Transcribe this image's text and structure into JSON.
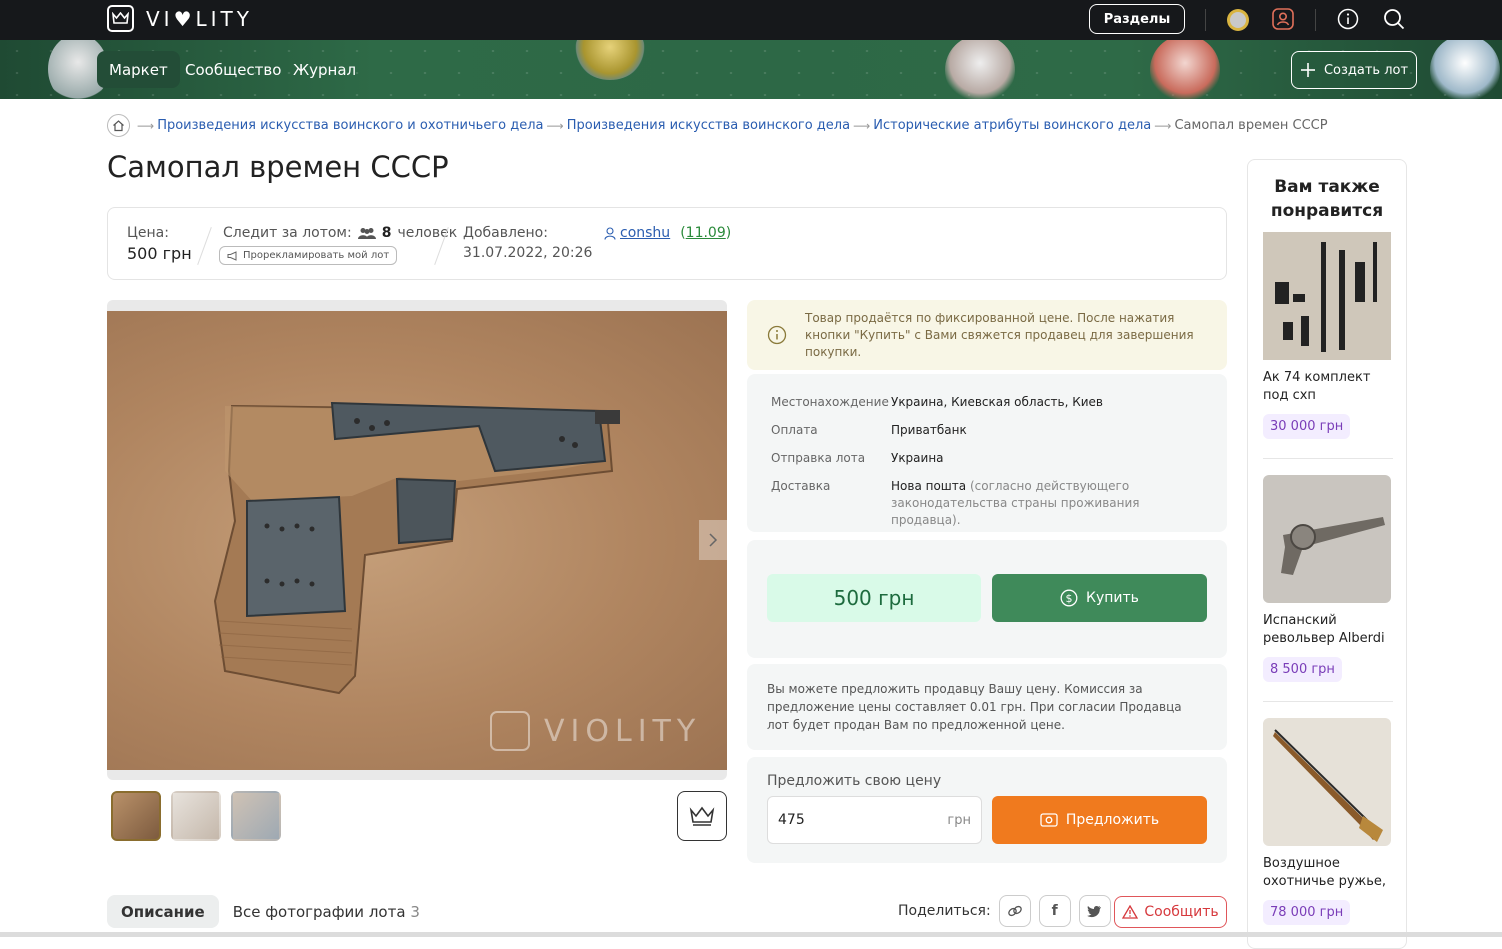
{
  "header": {
    "logo_text": "VI♥LITY",
    "sections_label": "Разделы"
  },
  "nav": {
    "items": [
      {
        "label": "Маркет"
      },
      {
        "label": "Сообщество"
      },
      {
        "label": "Журнал"
      }
    ],
    "create_lot_label": "Создать лот"
  },
  "breadcrumb": [
    "Произведения искусства воинского и охотничьего дела",
    "Произведения искусства воинского дела",
    "Исторические атрибуты воинского дела",
    "Самопал времен СССР"
  ],
  "lot": {
    "title": "Самопал времен СССР",
    "price_label": "Цена:",
    "price_value": "500 грн",
    "watchers_label": "Следит за лотом:",
    "watchers_count": "8",
    "watchers_unit": "человек",
    "promo_label": "Прорекламировать мой лот",
    "added_label": "Добавлено:",
    "added_value": "31.07.2022, 20:26",
    "seller_name": "conshu",
    "seller_rating": "11.09"
  },
  "notice": {
    "text": "Товар продаётся по фиксированной цене. После нажатия кнопки \"Купить\" с Вами свяжется продавец для завершения покупки."
  },
  "details": [
    {
      "key": "Местонахождение",
      "value": "Украина, Киевская область, Киев",
      "note": ""
    },
    {
      "key": "Оплата",
      "value": "Приватбанк",
      "note": ""
    },
    {
      "key": "Отправка лота",
      "value": "Украина",
      "note": ""
    },
    {
      "key": "Доставка",
      "value": "Нова пошта",
      "note": "(согласно действующего законодательства страны проживания продавца)."
    }
  ],
  "buy": {
    "price": "500 грн",
    "buy_label": "Купить"
  },
  "offer": {
    "info": "Вы можете предложить продавцу Вашу цену. Комиссия за предложение цены составляет 0.01 грн. При согласии Продавца лот будет продан Вам по предложенной цене.",
    "label": "Предложить свою цену",
    "input_value": "475",
    "currency": "грн",
    "button_label": "Предложить"
  },
  "gallery": {
    "watermark": "VIOLITY"
  },
  "tabs": {
    "description": "Описание",
    "all_photos": "Все фотографии лота",
    "photo_count": "3"
  },
  "share": {
    "label": "Поделиться:",
    "report_label": "Сообщить"
  },
  "sidebar": {
    "title": "Вам также понравится",
    "items": [
      {
        "name": "Ак 74 комплект под схп",
        "price": "30 000 грн"
      },
      {
        "name": "Испанский револьвер Alberdi",
        "price": "8 500 грн"
      },
      {
        "name": "Воздушное охотничье ружье,",
        "price": "78 000 грн"
      }
    ]
  },
  "colors": {
    "topbar": "#16181b",
    "banner_green": "#2e6a47",
    "buy_green": "#3f8a5a",
    "offer_orange": "#f07a1e",
    "price_purple": "#7a3db8"
  }
}
